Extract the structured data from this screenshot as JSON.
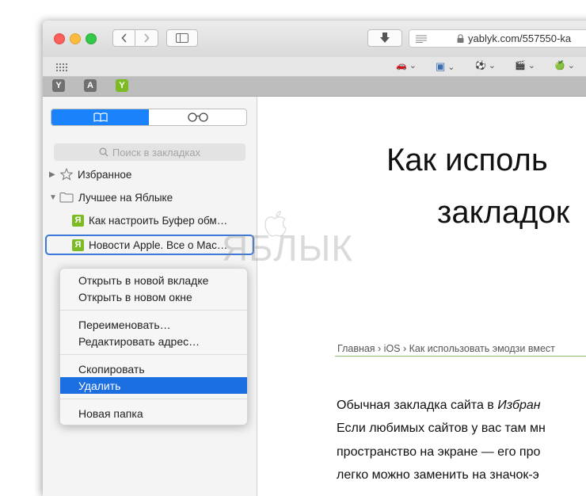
{
  "toolbar": {
    "url": "yablyk.com/557550-ka",
    "lock_icon": "lock-icon",
    "download_icon": "download-icon",
    "reader_icon": "reader-icon",
    "sidebar_icon": "sidebar-icon",
    "back_icon": "chevron-left-icon",
    "forward_icon": "chevron-right-icon"
  },
  "favorites_bar": {
    "items": [
      {
        "icon": "car-icon",
        "glyph": "🚗"
      },
      {
        "icon": "app-icon",
        "glyph": "▣"
      },
      {
        "icon": "football-icon",
        "glyph": "⚽"
      },
      {
        "icon": "clapper-icon",
        "glyph": "🎬"
      },
      {
        "icon": "apple-icon",
        "glyph": "🍏"
      }
    ],
    "chevron": "⌄"
  },
  "pinned_tabs": [
    {
      "letter": "Y",
      "color": "#707070"
    },
    {
      "letter": "A",
      "color": "#707070"
    },
    {
      "letter": "Y",
      "color": "#7dbb24"
    }
  ],
  "sidebar": {
    "search_placeholder": "Поиск в закладках",
    "favorites_label": "Избранное",
    "folder_label": "Лучшее на Яблыке",
    "bookmarks": [
      {
        "label": "Как настроить Буфер обм…"
      },
      {
        "label": "Новости Apple. Все о Mac…"
      }
    ],
    "favicon_letter": "Я"
  },
  "context_menu": {
    "items": [
      "Открыть в новой вкладке",
      "Открыть в новом окне",
      "Переименовать…",
      "Редактировать адрес…",
      "Скопировать",
      "Удалить",
      "Новая папка"
    ],
    "highlighted": "Удалить"
  },
  "page": {
    "headline_1": "Как исполь",
    "headline_2": "закладок",
    "breadcrumbs": "Главная  ›  iOS  ›  Как использовать эмодзи вмест",
    "para_1": "Обычная закладка сайта в ",
    "para_1_italic": "Избран",
    "para_2": "Если любимых сайтов у вас там мн",
    "para_3": "пространство на экране — его про",
    "para_4": "легко можно заменить на значок-э"
  },
  "watermark": "ЯБЛЫК",
  "colors": {
    "accent": "#1a82fb",
    "highlight": "#1b6fe0",
    "favicon_green": "#7dbb24"
  }
}
